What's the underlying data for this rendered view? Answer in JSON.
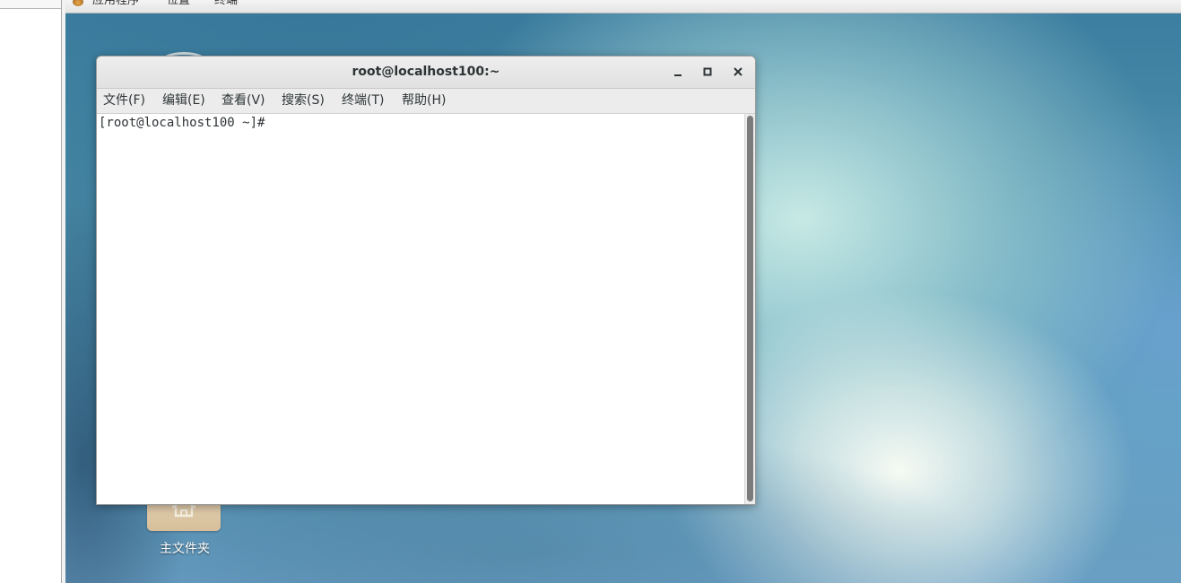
{
  "topbar": {
    "apps_label": "应用程序",
    "places_label": "位置",
    "terminal_label": "终端"
  },
  "desktop": {
    "home_folder_label": "主文件夹"
  },
  "terminal": {
    "title": "root@localhost100:~",
    "menu": [
      {
        "label": "文件(F)"
      },
      {
        "label": "编辑(E)"
      },
      {
        "label": "查看(V)"
      },
      {
        "label": "搜索(S)"
      },
      {
        "label": "终端(T)"
      },
      {
        "label": "帮助(H)"
      }
    ],
    "prompt": "[root@localhost100 ~]#"
  },
  "colors": {
    "desktop_blue": "#4c8fab",
    "desktop_glow": "#cdeee8",
    "titlebar": "#e8e8e8"
  },
  "icons": {
    "minimize": "minimize-icon",
    "maximize": "maximize-icon",
    "close": "close-icon",
    "home": "home-folder-icon",
    "apps": "applications-icon"
  }
}
